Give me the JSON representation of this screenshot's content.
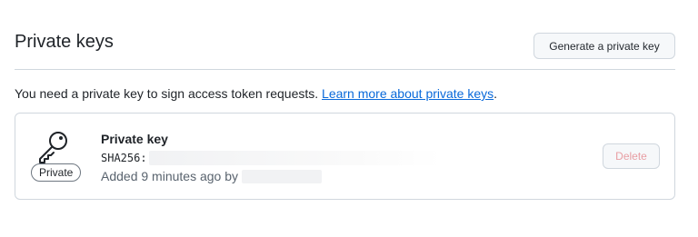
{
  "header": {
    "title": "Private keys",
    "generate_button": "Generate a private key"
  },
  "info": {
    "text": "You need a private key to sign access token requests. ",
    "link": "Learn more about private keys",
    "trailing": "."
  },
  "key": {
    "name": "Private key",
    "badge": "Private",
    "sha_label": "SHA256:",
    "added_text": "Added 9 minutes ago by",
    "delete_button": "Delete"
  },
  "colors": {
    "link": "#0969da",
    "border": "#d0d7de",
    "danger_disabled": "#e89ea3"
  },
  "icons": [
    "key-icon"
  ]
}
